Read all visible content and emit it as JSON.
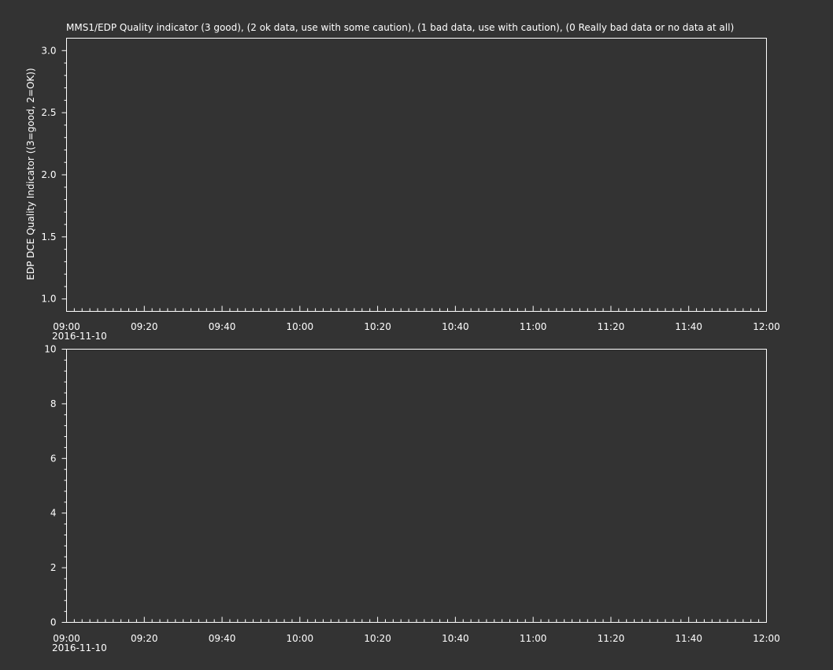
{
  "colors": {
    "background": "#333333",
    "axes": "#ffffff",
    "text": "#ffffff"
  },
  "chart_data": [
    {
      "type": "line",
      "title": "MMS1/EDP  Quality indicator (3 good), (2 ok data, use with some caution), (1 bad data, use with caution), (0 Really bad data or no data at all)",
      "ylabel": "EDP DCE Quality Indicator ((3=good, 2=OK))",
      "xlabel": "",
      "date_label": "2016-11-10",
      "x_ticks": [
        "09:00",
        "09:20",
        "09:40",
        "10:00",
        "10:20",
        "10:40",
        "11:00",
        "11:20",
        "11:40",
        "12:00"
      ],
      "x_minor_per_major": 10,
      "xlim": [
        "2016-11-10 09:00",
        "2016-11-10 12:00"
      ],
      "y_ticks": [
        "1.0",
        "1.5",
        "2.0",
        "2.5",
        "3.0"
      ],
      "y_tick_values": [
        1.0,
        1.5,
        2.0,
        2.5,
        3.0
      ],
      "y_minor_step": 0.1,
      "ylim": [
        0.9,
        3.1
      ],
      "grid": false,
      "series": []
    },
    {
      "type": "line",
      "title": "",
      "ylabel": "",
      "xlabel": "",
      "date_label": "2016-11-10",
      "x_ticks": [
        "09:00",
        "09:20",
        "09:40",
        "10:00",
        "10:20",
        "10:40",
        "11:00",
        "11:20",
        "11:40",
        "12:00"
      ],
      "x_minor_per_major": 10,
      "xlim": [
        "2016-11-10 09:00",
        "2016-11-10 12:00"
      ],
      "y_ticks": [
        "0",
        "2",
        "4",
        "6",
        "8",
        "10"
      ],
      "y_tick_values": [
        0,
        2,
        4,
        6,
        8,
        10
      ],
      "y_minor_step": 0.4,
      "ylim": [
        0,
        10
      ],
      "grid": false,
      "series": []
    }
  ]
}
